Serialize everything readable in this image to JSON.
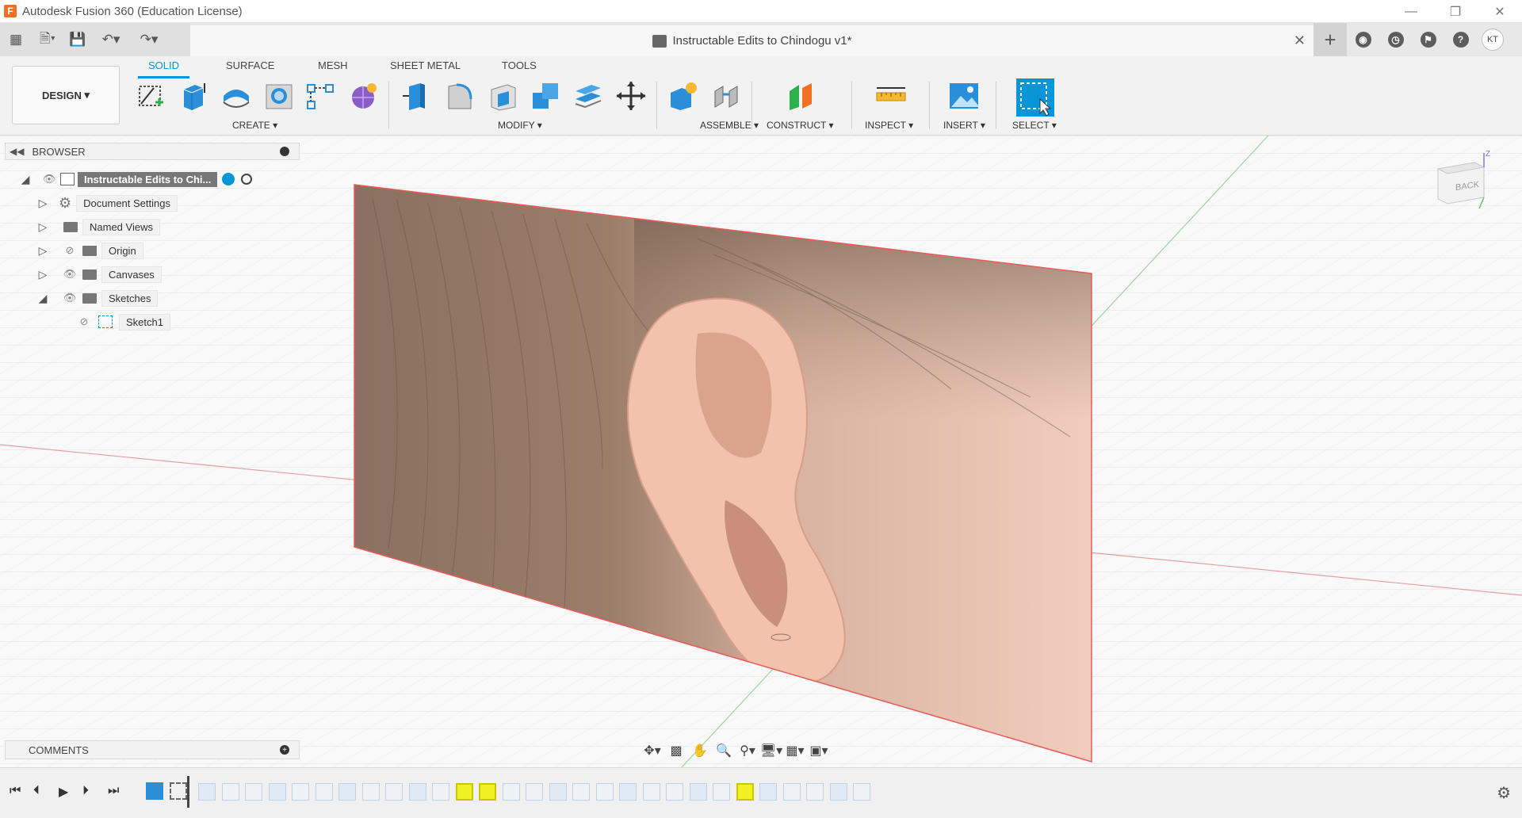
{
  "window": {
    "title": "Autodesk Fusion 360 (Education License)",
    "logo_letter": "F",
    "controls": [
      "minimize-icon",
      "restore-icon",
      "close-icon"
    ]
  },
  "quickbar": {
    "doc_title": "Instructable Edits to Chindogu v1*",
    "user_initials": "KT",
    "right_icons": [
      "add-tab-icon",
      "extensions-icon",
      "job-status-icon",
      "notifications-icon",
      "help-icon"
    ]
  },
  "ribbon": {
    "workspace": "DESIGN",
    "tabs": [
      {
        "label": "SOLID",
        "active": true
      },
      {
        "label": "SURFACE",
        "active": false
      },
      {
        "label": "MESH",
        "active": false
      },
      {
        "label": "SHEET METAL",
        "active": false
      },
      {
        "label": "TOOLS",
        "active": false
      }
    ],
    "groups": [
      {
        "label": "CREATE",
        "tools": [
          "create-sketch-icon",
          "extrude-icon",
          "revolve-icon",
          "hole-icon",
          "pattern-icon",
          "form-icon"
        ]
      },
      {
        "label": "MODIFY",
        "tools": [
          "press-pull-icon",
          "fillet-icon",
          "shell-icon",
          "combine-icon",
          "offset-face-icon",
          "move-icon"
        ]
      },
      {
        "label": "ASSEMBLE",
        "tools": [
          "new-component-icon",
          "joint-icon"
        ]
      },
      {
        "label": "CONSTRUCT",
        "tools": [
          "offset-plane-icon"
        ]
      },
      {
        "label": "INSPECT",
        "tools": [
          "measure-icon"
        ]
      },
      {
        "label": "INSERT",
        "tools": [
          "insert-canvas-icon"
        ]
      },
      {
        "label": "SELECT",
        "tools": [
          "select-icon"
        ]
      }
    ]
  },
  "browser": {
    "title": "BROWSER",
    "root_label": "Instructable Edits to Chi...",
    "items": [
      {
        "label": "Document Settings"
      },
      {
        "label": "Named Views"
      },
      {
        "label": "Origin"
      },
      {
        "label": "Canvases"
      },
      {
        "label": "Sketches"
      },
      {
        "label": "Sketch1"
      }
    ]
  },
  "viewcube": {
    "face_label": "BACK",
    "axis_label": "Z"
  },
  "comments": {
    "title": "COMMENTS"
  },
  "colors": {
    "accent": "#0696d7",
    "x_axis": "#e06060",
    "y_axis": "#70c070",
    "canvas_border": "#e85a5a"
  }
}
